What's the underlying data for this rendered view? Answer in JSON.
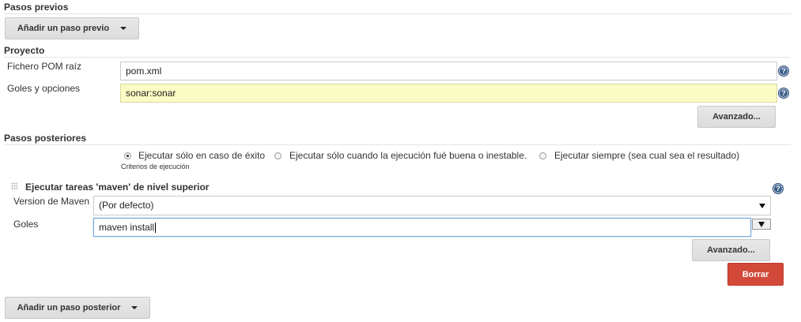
{
  "pre_steps": {
    "title": "Pasos previos",
    "add_button": "Añadir un paso previo"
  },
  "project": {
    "title": "Proyecto",
    "pom_label": "Fichero POM raíz",
    "pom_value": "pom.xml",
    "goals_label": "Goles y opciones",
    "goals_value": "sonar:sonar",
    "advanced_button": "Avanzado...",
    "help_glyph": "?"
  },
  "post_steps": {
    "title": "Pasos posteriores",
    "radio_options": [
      {
        "label": "Ejecutar sólo en caso de éxito",
        "selected": true
      },
      {
        "label": "Ejecutar sólo cuando la ejecución fué buena o inestable.",
        "selected": false
      },
      {
        "label": "Ejecutar siempre (sea cual sea el resultado)",
        "selected": false
      }
    ],
    "radio_caption": "Criterios de ejecución"
  },
  "maven_task": {
    "title": "Ejecutar tareas 'maven' de nivel superior",
    "version_label": "Version de Maven",
    "version_value": "(Por defecto)",
    "goals_label": "Goles",
    "goals_value": "maven install",
    "advanced_button": "Avanzado...",
    "delete_button": "Borrar"
  },
  "post_add_button": "Añadir un paso posterior",
  "colors": {
    "delete_button_bg": "#d24939",
    "yellow_field_bg": "#fbfbc4",
    "help_icon_bg": "#3b5f8a"
  }
}
